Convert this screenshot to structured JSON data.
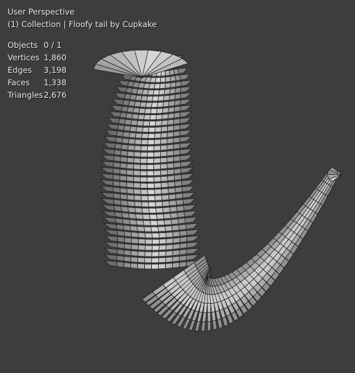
{
  "viewport": {
    "view_name": "User Perspective",
    "collection_line": "(1) Collection | Floofy tail by Cupkake",
    "background_color": "#3d3d3d",
    "mesh_color": "#bdbdbd",
    "wire_color": "#1a1a1a"
  },
  "stats": [
    {
      "label": "Objects",
      "value": "0 / 1"
    },
    {
      "label": "Vertices",
      "value": "1,860"
    },
    {
      "label": "Edges",
      "value": "3,198"
    },
    {
      "label": "Faces",
      "value": "1,338"
    },
    {
      "label": "Triangles",
      "value": "2,676"
    }
  ],
  "object": {
    "name": "Floofy tail by Cupkake",
    "icon": "mesh-object-icon"
  }
}
